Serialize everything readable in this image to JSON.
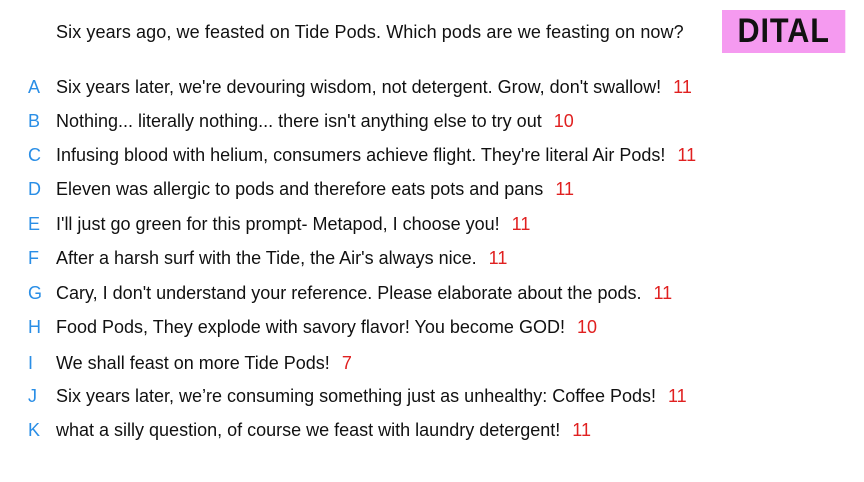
{
  "prompt": "Six years ago, we feasted on Tide Pods. Which pods are we feasting on now?",
  "player_badge": "DITAL",
  "colors": {
    "letter": "#2a8ee6",
    "score": "#e02020",
    "badge_bg": "#f59af0"
  },
  "responses": [
    {
      "letter": "A",
      "text": "Six years later, we're devouring wisdom, not detergent. Grow, don't swallow!",
      "score": "11"
    },
    {
      "letter": "B",
      "text": "Nothing... literally nothing... there isn't anything else to try out",
      "score": "10"
    },
    {
      "letter": "C",
      "text": "Infusing blood with helium, consumers achieve flight. They're literal Air Pods!",
      "score": "11"
    },
    {
      "letter": "D",
      "text": "Eleven was allergic to pods and therefore eats pots and pans",
      "score": "11"
    },
    {
      "letter": "E",
      "text": "I'll just go green for this prompt- Metapod, I choose you!",
      "score": "11"
    },
    {
      "letter": "F",
      "text": "After a harsh surf with the Tide, the Air's always nice.",
      "score": "11"
    },
    {
      "letter": "G",
      "text": "Cary, I don't understand your reference. Please elaborate about the pods.",
      "score": "11"
    },
    {
      "letter": "H",
      "text": "Food Pods, They explode with savory flavor! You become GOD!",
      "score": "10"
    },
    {
      "letter": "I",
      "text": "We shall feast on more Tide Pods!",
      "score": "7"
    },
    {
      "letter": "J",
      "text": "Six years later, we’re consuming something just as unhealthy: Coffee Pods!",
      "score": "11"
    },
    {
      "letter": "K",
      "text": "what a silly question, of course we feast with laundry detergent!",
      "score": "11"
    }
  ]
}
